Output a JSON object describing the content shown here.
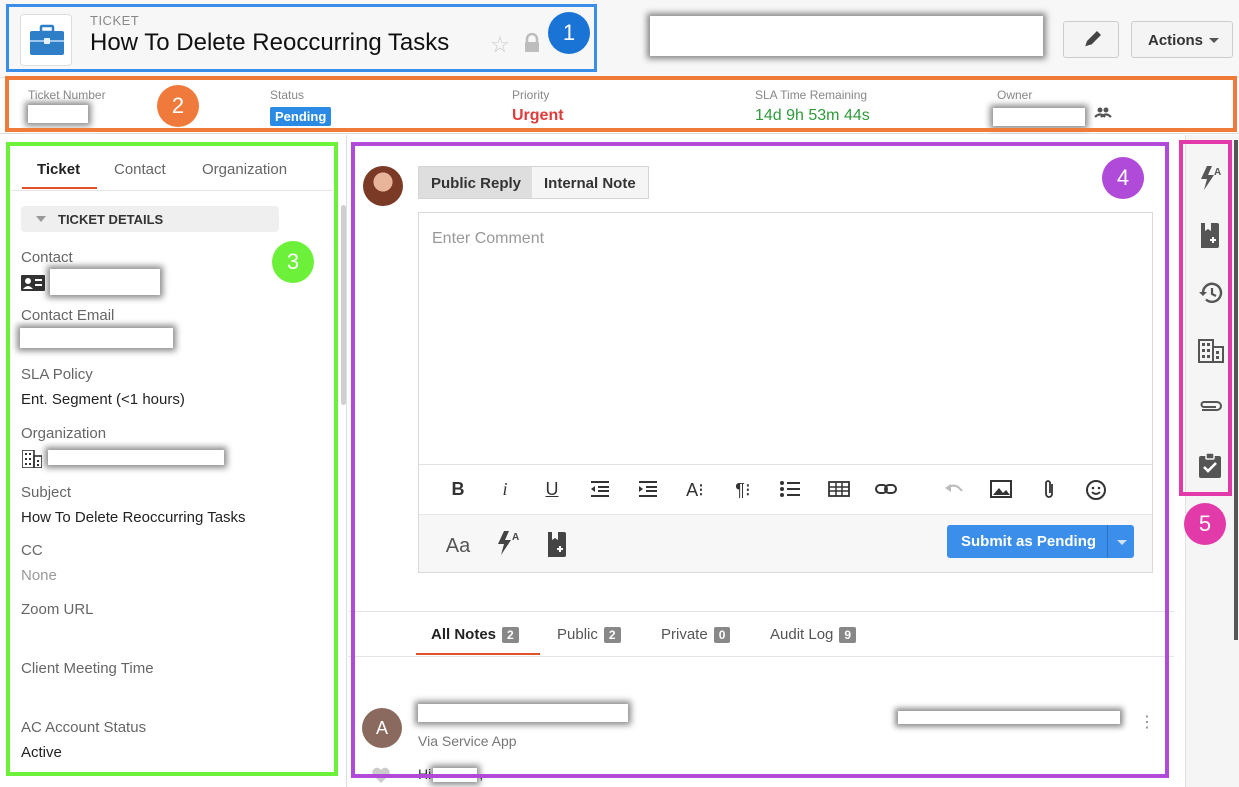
{
  "header": {
    "ticket_kind": "TICKET",
    "title": "How To Delete Reoccurring Tasks",
    "actions_label": "Actions"
  },
  "info": {
    "ticket_number_label": "Ticket Number",
    "status_label": "Status",
    "status_value": "Pending",
    "priority_label": "Priority",
    "priority_value": "Urgent",
    "sla_label": "SLA Time Remaining",
    "sla_value": "14d 9h 53m 44s",
    "owner_label": "Owner",
    "colors": {
      "status": "#2a8ae4",
      "priority": "#e03c3c",
      "sla": "#2f9a3a"
    }
  },
  "left": {
    "tabs": [
      "Ticket",
      "Contact",
      "Organization"
    ],
    "active_tab": "Ticket",
    "section": "TICKET DETAILS",
    "fields": [
      {
        "label": "Contact",
        "value": ""
      },
      {
        "label": "Contact Email",
        "value": ""
      },
      {
        "label": "SLA Policy",
        "value": "Ent. Segment (<1 hours)"
      },
      {
        "label": "Organization",
        "value": ""
      },
      {
        "label": "Subject",
        "value": "How To Delete Reoccurring Tasks"
      },
      {
        "label": "CC",
        "value": "None"
      },
      {
        "label": "Zoom URL",
        "value": ""
      },
      {
        "label": "Client Meeting Time",
        "value": ""
      },
      {
        "label": "AC Account Status",
        "value": "Active"
      }
    ]
  },
  "reply": {
    "tabs": [
      "Public Reply",
      "Internal Note"
    ],
    "active_tab": "Public Reply",
    "placeholder": "Enter Comment",
    "toolbar": [
      "B",
      "i",
      "U",
      "A⁝",
      "¶⁝"
    ],
    "font_label": "Aa",
    "submit_label": "Submit as Pending"
  },
  "notes": {
    "tabs": [
      {
        "label": "All Notes",
        "count": "2"
      },
      {
        "label": "Public",
        "count": "2"
      },
      {
        "label": "Private",
        "count": "0"
      },
      {
        "label": "Audit Log",
        "count": "9"
      }
    ],
    "active_tab": "All Notes",
    "entry": {
      "avatar_letter": "A",
      "via": "Via Service App",
      "body_start": "Hi",
      "body_end": ","
    }
  },
  "rail": {
    "icons": [
      "macro-icon",
      "knowledge-base-icon",
      "history-icon",
      "organization-icon",
      "attachment-icon",
      "task-icon"
    ]
  },
  "callouts": [
    {
      "number": "1",
      "color": "#1a74d6"
    },
    {
      "number": "2",
      "color": "#f07a3c"
    },
    {
      "number": "3",
      "color": "#6cf03a"
    },
    {
      "number": "4",
      "color": "#b04ad8"
    },
    {
      "number": "5",
      "color": "#e23aa8"
    }
  ]
}
